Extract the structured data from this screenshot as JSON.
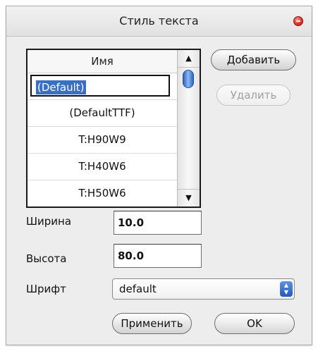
{
  "window": {
    "title": "Стиль текста"
  },
  "style_list": {
    "header": "Имя",
    "items": [
      {
        "label": "(Default)",
        "selected": true
      },
      {
        "label": "(DefaultTTF)",
        "selected": false
      },
      {
        "label": "T:H90W9",
        "selected": false
      },
      {
        "label": "T:H40W6",
        "selected": false
      },
      {
        "label": "T:H50W6",
        "selected": false
      }
    ],
    "scroll_up_icon": "▲",
    "scroll_down_icon": "▼"
  },
  "buttons": {
    "add": "Добавить",
    "delete": "Удалить",
    "apply": "Применить",
    "ok": "OK"
  },
  "fields": {
    "width_label": "Ширина",
    "width_value": "10.0",
    "height_label": "Высота",
    "height_value": "80.0",
    "font_label": "Шрифт",
    "font_value": "default"
  },
  "colors": {
    "selection": "#3a6fc4",
    "close_button": "#d9342a",
    "scroll_thumb": "#2e64c0"
  }
}
